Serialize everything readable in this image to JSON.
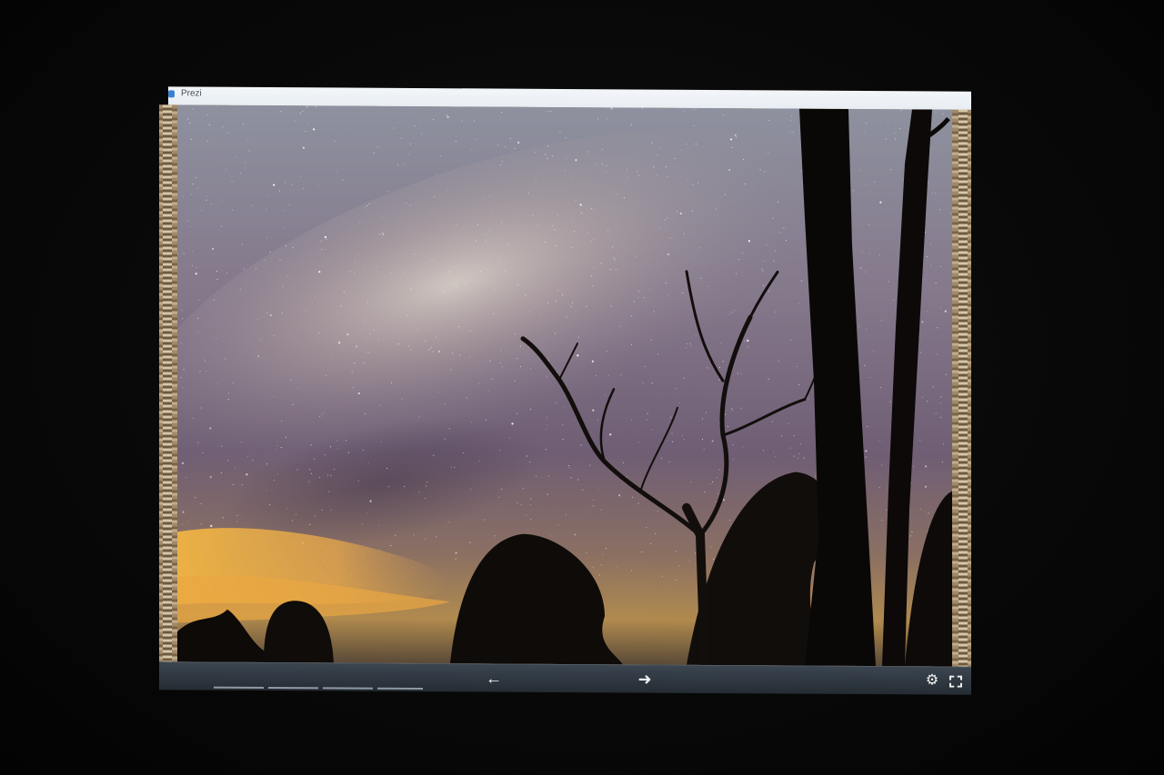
{
  "window": {
    "title": "Prezi",
    "minimize_glyph": "–",
    "maximize_glyph": "□",
    "close_glyph": "✕"
  },
  "slide": {
    "image_subject": "night sky with milky way and tree silhouettes"
  },
  "controls": {
    "back_glyph": "←",
    "next_glyph": "➜",
    "settings_glyph": "⚙",
    "back_icon": "arrow-left-icon",
    "next_icon": "hand-pointer-icon",
    "settings_icon": "gear-icon",
    "fullscreen_icon": "fullscreen-icon"
  },
  "colors": {
    "titlebar": "#e6edf3",
    "close_button": "#c0392b",
    "controlbar": "#2c343c",
    "sky_top": "#7b7e8c",
    "horizon_glow": "#e8b04a"
  }
}
